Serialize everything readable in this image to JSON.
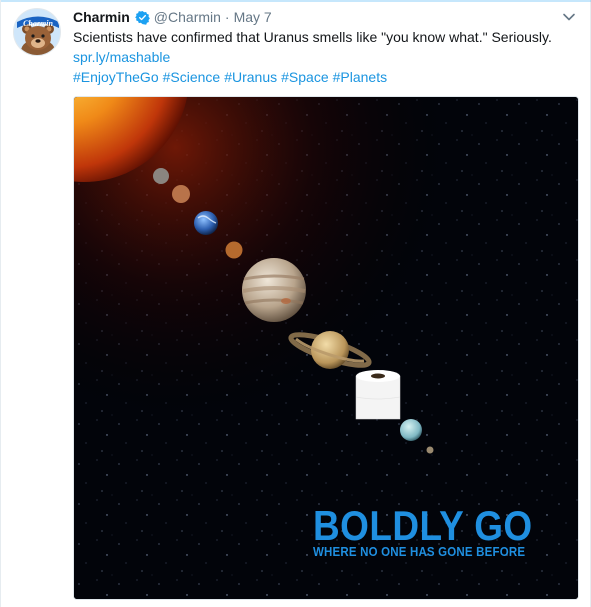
{
  "tweet": {
    "author_name": "Charmin",
    "handle": "@Charmin",
    "separator": "·",
    "timestamp": "May 7",
    "text": "Scientists have confirmed that Uranus smells like \"you know what.\" Seriously.",
    "link": "spr.ly/mashable",
    "hashtags": [
      "#EnjoyTheGo",
      "#Science",
      "#Uranus",
      "#Space",
      "#Planets"
    ],
    "avatar_logo_text": "Charmin"
  },
  "media": {
    "headline": "BOLDLY GO",
    "tagline": "WHERE NO ONE HAS GONE BEFORE"
  },
  "icons": {
    "verified": "verified-badge-icon",
    "caret": "chevron-down-icon"
  },
  "colors": {
    "link": "#1b95e0",
    "text": "#14171a",
    "muted": "#657786",
    "verified": "#1da1f2",
    "ad_text": "#1f8fe0"
  }
}
